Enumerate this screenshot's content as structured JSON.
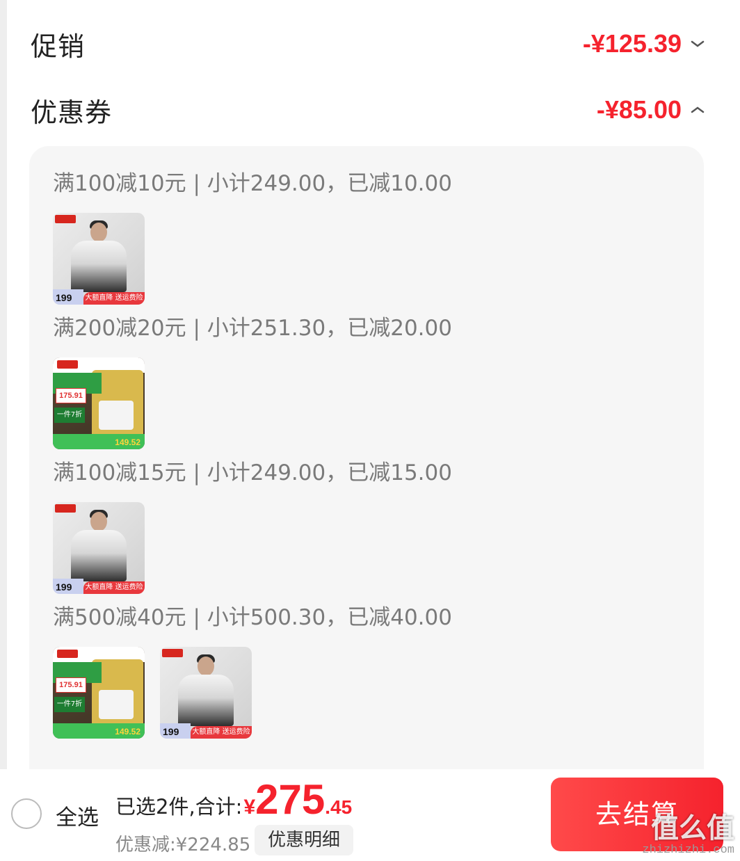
{
  "promotion": {
    "label": "促销",
    "amount": "-¥125.39"
  },
  "coupon": {
    "label": "优惠券",
    "amount": "-¥85.00",
    "groups": [
      {
        "title": "满100减10元 | 小计249.00，已减10.00",
        "items": [
          {
            "type": "jacket",
            "price": "199",
            "banner": "大额直降 送运费险"
          }
        ]
      },
      {
        "title": "满200减20元 | 小计251.30，已减20.00",
        "items": [
          {
            "type": "socket",
            "price": "175.91",
            "promo": "一件7折",
            "bottom_price": "149.52"
          }
        ]
      },
      {
        "title": "满100减15元 | 小计249.00，已减15.00",
        "items": [
          {
            "type": "jacket",
            "price": "199",
            "banner": "大额直降 送运费险"
          }
        ]
      },
      {
        "title": "满500减40元 | 小计500.30，已减40.00",
        "items": [
          {
            "type": "socket",
            "price": "175.91",
            "promo": "一件7折",
            "bottom_price": "149.52"
          },
          {
            "type": "jacket",
            "price": "199",
            "banner": "大额直降 送运费险"
          }
        ]
      }
    ]
  },
  "footer": {
    "select_all": "全选",
    "selected_text": "已选2件,合计:",
    "currency": "¥",
    "total_int": "275",
    "total_dec": ".45",
    "discount_text": "优惠减:¥224.85",
    "detail_button": "优惠明细",
    "checkout_button": "去结算"
  },
  "watermark": {
    "main": "值么值",
    "sub": "zhizhizhi.com"
  },
  "colors": {
    "accent": "#f5222d",
    "panel": "#f6f6f6"
  },
  "icons": {
    "promotion_toggle": "chevron-down-icon",
    "coupon_toggle": "chevron-up-icon"
  }
}
